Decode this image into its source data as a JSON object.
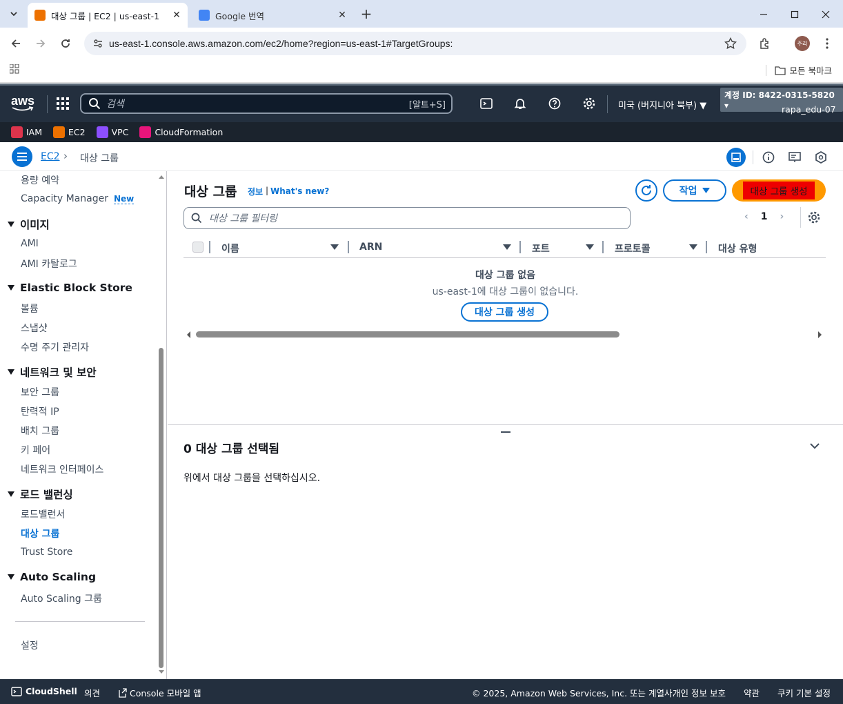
{
  "browser": {
    "tabs": [
      {
        "title": "대상 그룹 | EC2 | us-east-1",
        "active": true
      },
      {
        "title": "Google 번역",
        "active": false
      }
    ],
    "url": "us-east-1.console.aws.amazon.com/ec2/home?region=us-east-1#TargetGroups:",
    "profile_initials": "주리",
    "bookmarks_label": "모든 북마크"
  },
  "aws_header": {
    "logo": "aws",
    "search_placeholder": "검색",
    "search_shortcut": "[알트+S]",
    "region": "미국 (버지니아 북부)",
    "account_id": "계정 ID: 8422-0315-5820",
    "username": "rapa_edu-07"
  },
  "favorites": [
    {
      "label": "IAM",
      "color": "#dd344c"
    },
    {
      "label": "EC2",
      "color": "#ed7100"
    },
    {
      "label": "VPC",
      "color": "#8c4fff"
    },
    {
      "label": "CloudFormation",
      "color": "#e7157b"
    }
  ],
  "breadcrumb": {
    "service": "EC2",
    "current": "대상 그룹"
  },
  "sidebar": {
    "top_items": [
      "용량 예약",
      "Capacity Manager"
    ],
    "new_badge": "New",
    "sections": [
      {
        "title": "이미지",
        "items": [
          "AMI",
          "AMI 카탈로그"
        ]
      },
      {
        "title": "Elastic Block Store",
        "items": [
          "볼륨",
          "스냅샷",
          "수명 주기 관리자"
        ]
      },
      {
        "title": "네트워크 및 보안",
        "items": [
          "보안 그룹",
          "탄력적 IP",
          "배치 그룹",
          "키 페어",
          "네트워크 인터페이스"
        ]
      },
      {
        "title": "로드 밸런싱",
        "items": [
          "로드밸런서",
          "대상 그룹",
          "Trust Store"
        ]
      },
      {
        "title": "Auto Scaling",
        "items": [
          "Auto Scaling 그룹"
        ]
      }
    ],
    "settings": "설정",
    "active_item": "대상 그룹"
  },
  "main": {
    "title": "대상 그룹",
    "info_link": "정보",
    "whats_new": "What's new?",
    "actions_button": "작업",
    "create_button": "대상 그룹 생성",
    "filter_placeholder": "대상 그룹 필터링",
    "page_number": "1",
    "columns": [
      "이름",
      "ARN",
      "포트",
      "프로토콜",
      "대상 유형"
    ],
    "empty_title": "대상 그룹 없음",
    "empty_desc": "us-east-1에 대상 그룹이 없습니다.",
    "empty_button": "대상 그룹 생성",
    "selected_title": "0 대상 그룹 선택됨",
    "selected_desc": "위에서 대상 그룹을 선택하십시오."
  },
  "footer": {
    "cloudshell": "CloudShell",
    "feedback": "의견",
    "mobile": "Console 모바일 앱",
    "copyright": "© 2025, Amazon Web Services, Inc. 또는 계열사.",
    "privacy": "개인 정보 보호",
    "terms": "약관",
    "cookies": "쿠키 기본 설정"
  },
  "colors": {
    "accent": "#0972d3",
    "nav_bg": "#232f3e",
    "orange": "#ff9900"
  }
}
